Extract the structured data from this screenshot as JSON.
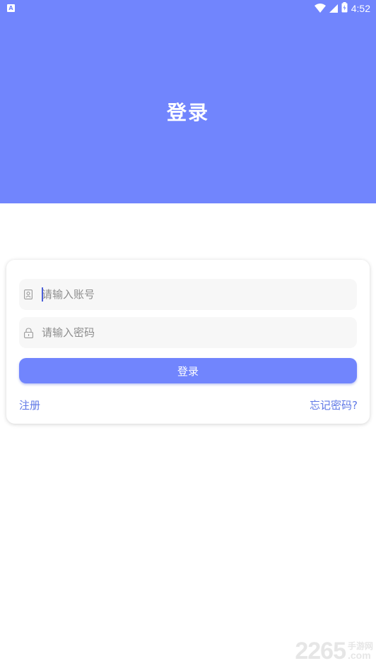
{
  "status_bar": {
    "notification_icon": "app-notification-icon",
    "time": "4:52",
    "icons": [
      "wifi-icon",
      "signal-icon",
      "battery-icon"
    ]
  },
  "header": {
    "title": "登录",
    "background_color": "#7185fd"
  },
  "form": {
    "account": {
      "icon": "user-card-icon",
      "placeholder": "请输入账号",
      "value": ""
    },
    "password": {
      "icon": "lock-icon",
      "placeholder": "请输入密码",
      "value": ""
    },
    "login_button_label": "登录",
    "register_link": "注册",
    "forgot_link": "忘记密码?"
  },
  "watermark": {
    "number": "2265",
    "site_cn": "手游网",
    "suffix": ".com"
  },
  "colors": {
    "accent": "#7185fd",
    "link": "#5f78e6",
    "field_bg": "#f7f7f7"
  }
}
